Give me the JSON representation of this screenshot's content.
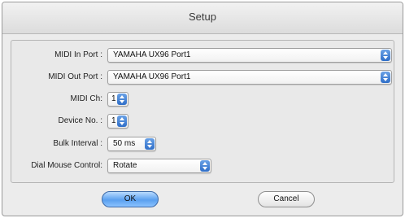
{
  "window": {
    "title": "Setup"
  },
  "form": {
    "midi_in_port": {
      "label": "MIDI In Port :",
      "value": "YAMAHA UX96 Port1"
    },
    "midi_out_port": {
      "label": "MIDI Out Port :",
      "value": "YAMAHA UX96 Port1"
    },
    "midi_ch": {
      "label": "MIDI Ch:",
      "value": "1"
    },
    "device_no": {
      "label": "Device No. :",
      "value": "1"
    },
    "bulk_interval": {
      "label": "Bulk Interval :",
      "value": "50 ms"
    },
    "dial_mouse_control": {
      "label": "Dial Mouse Control:",
      "value": "Rotate"
    }
  },
  "buttons": {
    "ok": "OK",
    "cancel": "Cancel"
  },
  "colors": {
    "accent": "#5aa0ef",
    "window_bg": "#ececec"
  },
  "icons": {
    "popup_stepper": "up-down-arrows-icon"
  }
}
